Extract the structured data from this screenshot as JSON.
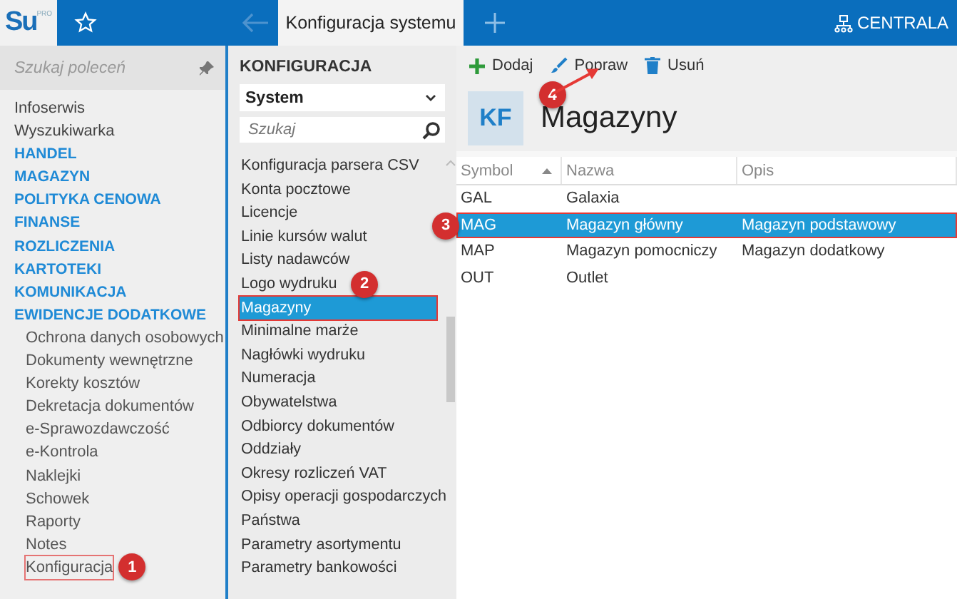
{
  "topbar": {
    "logo": "Su",
    "logo_sup": "PRO",
    "active_tab": "Konfiguracja systemu",
    "company": "CENTRALA"
  },
  "sidebar": {
    "search": {
      "placeholder": "Szukaj poleceń"
    },
    "items": [
      {
        "label": "Infoserwis",
        "kind": "link",
        "annotated": false
      },
      {
        "label": "Wyszukiwarka",
        "kind": "link",
        "annotated": false
      },
      {
        "label": "HANDEL",
        "kind": "section",
        "annotated": false
      },
      {
        "label": "MAGAZYN",
        "kind": "section",
        "annotated": false
      },
      {
        "label": "POLITYKA CENOWA",
        "kind": "section",
        "annotated": false
      },
      {
        "label": "FINANSE",
        "kind": "section",
        "annotated": false
      },
      {
        "label": "ROZLICZENIA",
        "kind": "section",
        "annotated": false
      },
      {
        "label": "KARTOTEKI",
        "kind": "section",
        "annotated": false
      },
      {
        "label": "KOMUNIKACJA",
        "kind": "section",
        "annotated": false
      },
      {
        "label": "EWIDENCJE DODATKOWE",
        "kind": "section",
        "annotated": false,
        "children": [
          {
            "label": "Ochrona danych osobowych",
            "annotated": false
          },
          {
            "label": "Dokumenty wewnętrzne",
            "annotated": false
          },
          {
            "label": "Korekty kosztów",
            "annotated": false
          },
          {
            "label": "Dekretacja dokumentów",
            "annotated": false
          },
          {
            "label": "e-Sprawozdawczość",
            "annotated": false
          },
          {
            "label": "e-Kontrola",
            "annotated": false
          },
          {
            "label": "Naklejki",
            "annotated": false
          },
          {
            "label": "Schowek",
            "annotated": false
          },
          {
            "label": "Raporty",
            "annotated": false
          },
          {
            "label": "Notes",
            "annotated": false
          },
          {
            "label": "Konfiguracja",
            "annotated": true,
            "badge": "1"
          }
        ]
      }
    ]
  },
  "config": {
    "title": "KONFIGURACJA",
    "dropdown": "System",
    "search": {
      "placeholder": "Szukaj"
    },
    "items": [
      {
        "label": "Konfiguracja parsera CSV",
        "selected": false
      },
      {
        "label": "Konta pocztowe",
        "selected": false
      },
      {
        "label": "Licencje",
        "selected": false
      },
      {
        "label": "Linie kursów walut",
        "selected": false
      },
      {
        "label": "Listy nadawców",
        "selected": false
      },
      {
        "label": "Logo wydruku",
        "selected": false
      },
      {
        "label": "Magazyny",
        "selected": true,
        "badge": "2"
      },
      {
        "label": "Minimalne marże",
        "selected": false
      },
      {
        "label": "Nagłówki wydruku",
        "selected": false
      },
      {
        "label": "Numeracja",
        "selected": false
      },
      {
        "label": "Obywatelstwa",
        "selected": false
      },
      {
        "label": "Odbiorcy dokumentów",
        "selected": false
      },
      {
        "label": "Oddziały",
        "selected": false
      },
      {
        "label": "Okresy rozliczeń VAT",
        "selected": false
      },
      {
        "label": "Opisy operacji gospodarczych",
        "selected": false
      },
      {
        "label": "Państwa",
        "selected": false
      },
      {
        "label": "Parametry asortymentu",
        "selected": false
      },
      {
        "label": "Parametry bankowości",
        "selected": false
      }
    ]
  },
  "toolbar": [
    {
      "label": "Dodaj",
      "kind": "add"
    },
    {
      "label": "Popraw",
      "kind": "edit",
      "badge": "4"
    },
    {
      "label": "Usuń",
      "kind": "delete"
    }
  ],
  "header": {
    "icon_text": "KF",
    "title": "Magazyny"
  },
  "table": {
    "columns": [
      "Symbol",
      "Nazwa",
      "Opis"
    ],
    "rows": [
      {
        "cells": [
          "GAL",
          "Galaxia",
          ""
        ],
        "selected": false
      },
      {
        "cells": [
          "MAG",
          "Magazyn główny",
          "Magazyn podstawowy"
        ],
        "selected": true,
        "badge": "3"
      },
      {
        "cells": [
          "MAP",
          "Magazyn pomocniczy",
          "Magazyn dodatkowy"
        ],
        "selected": false
      },
      {
        "cells": [
          "OUT",
          "Outlet",
          ""
        ],
        "selected": false
      }
    ]
  }
}
